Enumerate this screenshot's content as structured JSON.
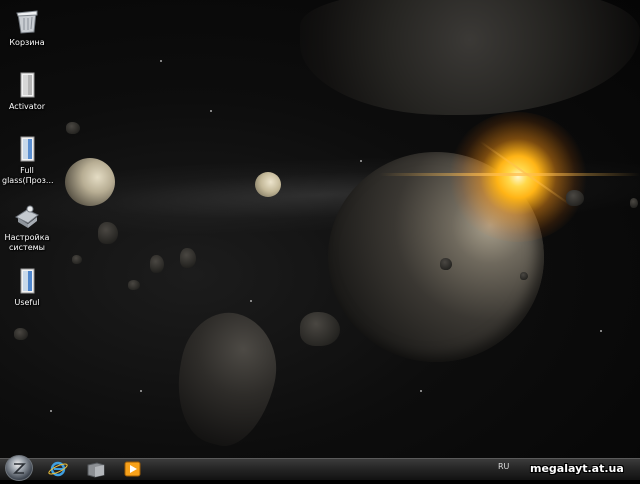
{
  "desktop": {
    "icons": [
      {
        "label": "Корзина",
        "icon": "recycle-bin-icon"
      },
      {
        "label": "Activator",
        "icon": "folder-icon"
      },
      {
        "label": "Full glass(Проз...",
        "icon": "folder-icon"
      },
      {
        "label": "Настройка системы",
        "icon": "settings-icon"
      },
      {
        "label": "Useful",
        "icon": "folder-icon"
      }
    ]
  },
  "taskbar": {
    "start_icon": "start-orb-icon",
    "pinned": [
      {
        "icon": "internet-explorer-icon"
      },
      {
        "icon": "explorer-folder-icon"
      },
      {
        "icon": "media-player-icon"
      }
    ],
    "language": "RU"
  },
  "watermark": "megalayt.at.ua"
}
